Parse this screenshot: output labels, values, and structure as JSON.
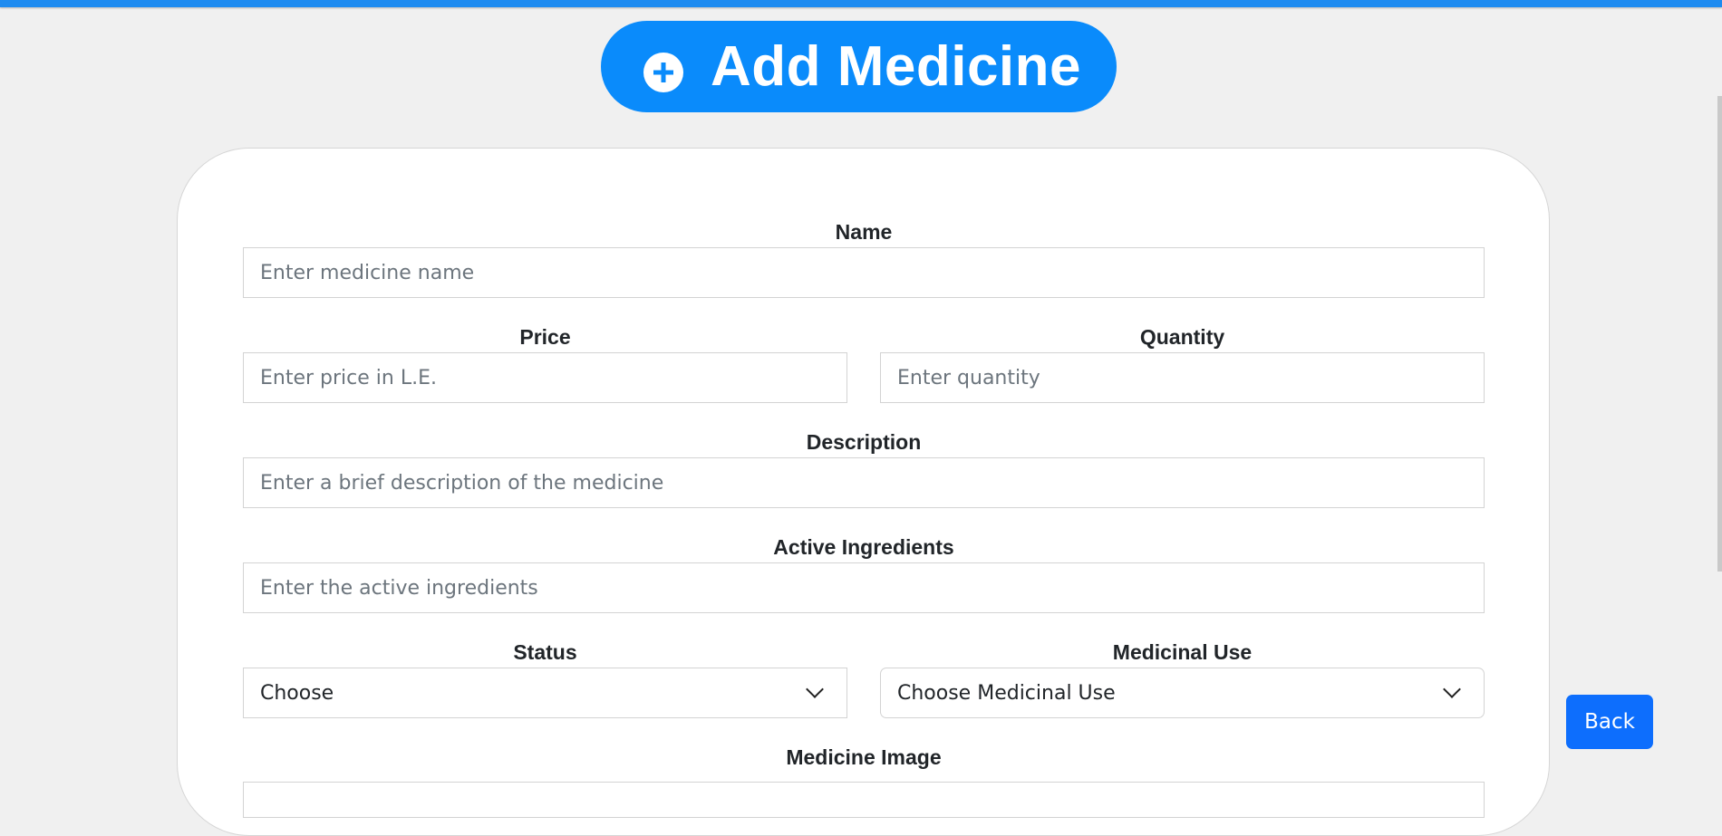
{
  "header": {
    "title": "Add Medicine",
    "icon": "plus-circle-icon",
    "accent_color": "#0a8bfb"
  },
  "form": {
    "name": {
      "label": "Name",
      "placeholder": "Enter medicine name"
    },
    "price": {
      "label": "Price",
      "placeholder": "Enter price in L.E."
    },
    "quantity": {
      "label": "Quantity",
      "placeholder": "Enter quantity"
    },
    "description": {
      "label": "Description",
      "placeholder": "Enter a brief description of the medicine"
    },
    "ingredients": {
      "label": "Active Ingredients",
      "placeholder": "Enter the active ingredients"
    },
    "status": {
      "label": "Status",
      "selected": "Choose"
    },
    "medicinal_use": {
      "label": "Medicinal Use",
      "selected": "Choose Medicinal Use"
    },
    "image": {
      "label": "Medicine Image"
    }
  },
  "actions": {
    "back_label": "Back",
    "back_color": "#0d6efd"
  }
}
